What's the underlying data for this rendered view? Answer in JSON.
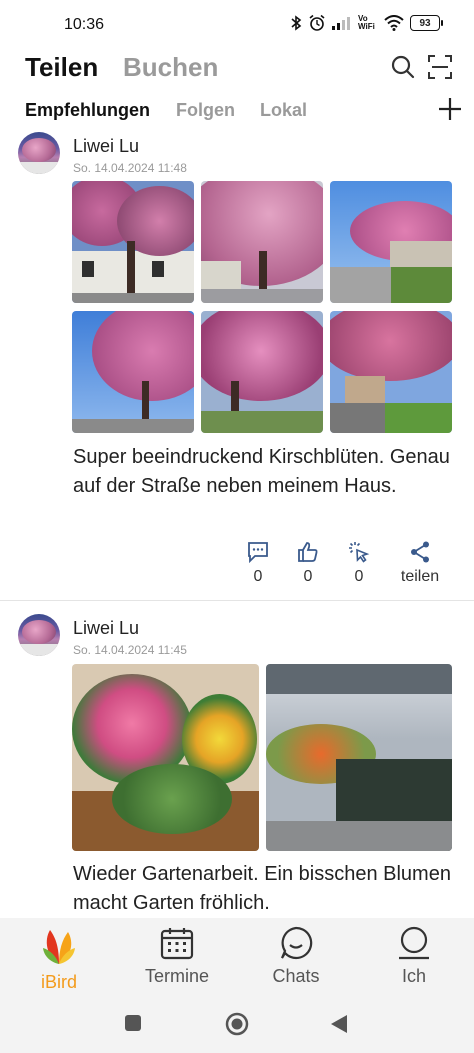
{
  "status_bar": {
    "time": "10:36",
    "network_label": "Vo WiFi",
    "battery": "93"
  },
  "header": {
    "tab_active": "Teilen",
    "tab_inactive": "Buchen"
  },
  "subtabs": {
    "items": [
      "Empfehlungen",
      "Folgen",
      "Lokal"
    ]
  },
  "posts": [
    {
      "author": "Liwei Lu",
      "date": "So. 14.04.2024 11:48",
      "text": "Super beeindruckend Kirschblüten. Genau auf der Straße neben meinem Haus.",
      "comments": "0",
      "likes": "0",
      "clicks": "0",
      "share_label": "teilen"
    },
    {
      "author": "Liwei Lu",
      "date": "So. 14.04.2024 11:45",
      "text": "Wieder Gartenarbeit. Ein bisschen Blumen macht Garten fröhlich."
    }
  ],
  "bottom_nav": {
    "items": [
      {
        "label": "iBird",
        "icon": "ibird-logo-icon",
        "active": true
      },
      {
        "label": "Termine",
        "icon": "calendar-icon",
        "active": false
      },
      {
        "label": "Chats",
        "icon": "chat-bubble-icon",
        "active": false
      },
      {
        "label": "Ich",
        "icon": "person-icon",
        "active": false
      }
    ]
  },
  "colors": {
    "accent": "#f39b1c",
    "inactive_text": "#9a9a9a",
    "icon_blue": "#3a5a8c"
  }
}
